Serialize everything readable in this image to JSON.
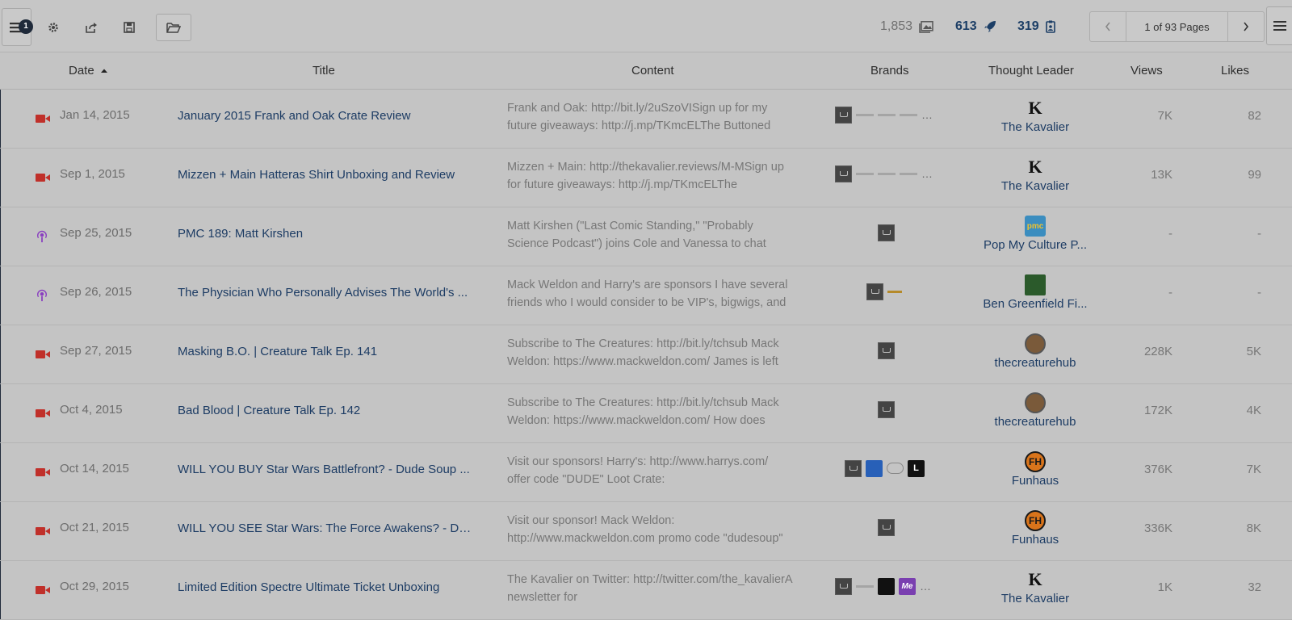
{
  "toolbar": {
    "notification_count": "1",
    "stats": [
      {
        "value": "1,853",
        "icon": "images-icon"
      },
      {
        "value": "613",
        "icon": "rocket-icon"
      },
      {
        "value": "319",
        "icon": "badge-icon"
      }
    ],
    "pager_text": "1 of 93 Pages"
  },
  "columns": {
    "date": "Date",
    "title": "Title",
    "content": "Content",
    "brands": "Brands",
    "leader": "Thought Leader",
    "views": "Views",
    "likes": "Likes"
  },
  "colors": {
    "link": "#1d3c64",
    "video_icon": "#c0302a",
    "podcast_icon": "#8a3fc0"
  },
  "rows": [
    {
      "type": "video",
      "date": "Jan 14, 2015",
      "title": "January 2015 Frank and Oak Crate Review",
      "content": "Frank and Oak: http://bit.ly/2uSzoVISign up for my future giveaways: http://j.mp/TKmcELThe Buttoned",
      "leader": "The Kavalier",
      "views": "7K",
      "likes": "82"
    },
    {
      "type": "video",
      "date": "Sep 1, 2015",
      "title": "Mizzen + Main Hatteras Shirt Unboxing and Review",
      "content": "Mizzen + Main: http://thekavalier.reviews/M-MSign up for future giveaways: http://j.mp/TKmcELThe",
      "leader": "The Kavalier",
      "views": "13K",
      "likes": "99"
    },
    {
      "type": "podcast",
      "date": "Sep 25, 2015",
      "title": "PMC 189: Matt Kirshen",
      "content": "Matt Kirshen (\"Last Comic Standing,\" \"Probably Science Podcast\") joins Cole and Vanessa to chat",
      "leader": "Pop My Culture P...",
      "views": "-",
      "likes": "-"
    },
    {
      "type": "podcast",
      "date": "Sep 26, 2015",
      "title": "The Physician Who Personally Advises The World's ...",
      "content": "Mack Weldon and Harry's are sponsors I have several friends who I would consider to be VIP's, bigwigs, and",
      "leader": "Ben Greenfield Fi...",
      "views": "-",
      "likes": "-"
    },
    {
      "type": "video",
      "date": "Sep 27, 2015",
      "title": "Masking B.O. | Creature Talk Ep. 141",
      "content": "Subscribe to The Creatures: http://bit.ly/tchsub Mack Weldon: https://www.mackweldon.com/ James is left",
      "leader": "thecreaturehub",
      "views": "228K",
      "likes": "5K"
    },
    {
      "type": "video",
      "date": "Oct 4, 2015",
      "title": "Bad Blood | Creature Talk Ep. 142",
      "content": "Subscribe to The Creatures: http://bit.ly/tchsub Mack Weldon: https://www.mackweldon.com/ How does",
      "leader": "thecreaturehub",
      "views": "172K",
      "likes": "4K"
    },
    {
      "type": "video",
      "date": "Oct 14, 2015",
      "title": "WILL YOU BUY Star Wars Battlefront? - Dude Soup ...",
      "content": "Visit our sponsors! Harry's: http://www.harrys.com/ offer code \"DUDE\" Loot Crate:",
      "leader": "Funhaus",
      "views": "376K",
      "likes": "7K"
    },
    {
      "type": "video",
      "date": "Oct 21, 2015",
      "title": "WILL YOU SEE Star Wars: The Force Awakens? - Du...",
      "content": "Visit our sponsor! Mack Weldon: http://www.mackweldon.com promo code \"dudesoup\"",
      "leader": "Funhaus",
      "views": "336K",
      "likes": "8K"
    },
    {
      "type": "video",
      "date": "Oct 29, 2015",
      "title": "Limited Edition Spectre Ultimate Ticket Unboxing",
      "content": "The Kavalier on Twitter: http://twitter.com/the_kavalierA newsletter for",
      "leader": "The Kavalier",
      "views": "1K",
      "likes": "32"
    }
  ]
}
